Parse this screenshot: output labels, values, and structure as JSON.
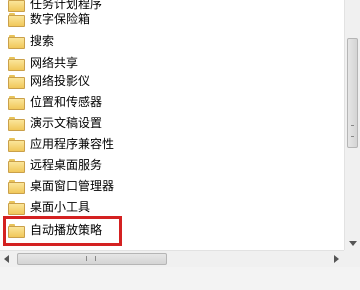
{
  "tree": {
    "items": [
      {
        "label": "任务计划程序"
      },
      {
        "label": "数字保险箱"
      },
      {
        "label": "搜索"
      },
      {
        "label": "网络共享"
      },
      {
        "label": "网络投影仪"
      },
      {
        "label": "位置和传感器"
      },
      {
        "label": "演示文稿设置"
      },
      {
        "label": "应用程序兼容性"
      },
      {
        "label": "远程桌面服务"
      },
      {
        "label": "桌面窗口管理器"
      },
      {
        "label": "桌面小工具"
      },
      {
        "label": "自动播放策略"
      }
    ],
    "highlighted_item": "自动播放策略"
  },
  "colors": {
    "highlight_border": "#d42121",
    "folder": "#f1c75a"
  }
}
